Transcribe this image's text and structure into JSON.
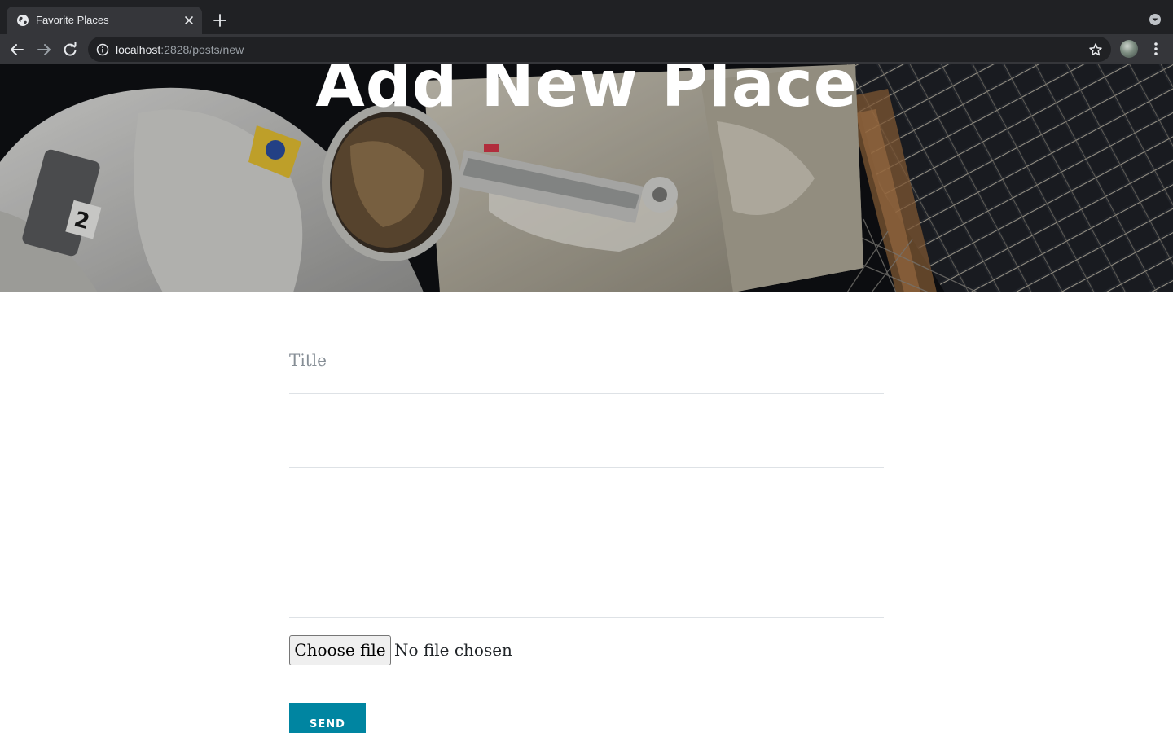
{
  "browser": {
    "tab_title": "Favorite Places",
    "url_host": "localhost",
    "url_rest": ":2828/posts/new"
  },
  "icons": {
    "favicon": "globe-icon",
    "tab_close": "close-icon",
    "new_tab": "plus-icon",
    "tabstrip_menu": "chevron-down-icon",
    "back": "arrow-left-icon",
    "forward": "arrow-right-icon",
    "reload": "reload-icon",
    "site_info": "info-icon",
    "bookmark": "star-icon",
    "menu": "kebab-menu-icon"
  },
  "hero": {
    "title": "Add New Place"
  },
  "form": {
    "title_placeholder": "Title",
    "file_button_label": "Choose file",
    "file_status": "No file chosen",
    "send_label": "SEND"
  },
  "colors": {
    "accent": "#0085a1",
    "chrome_dark": "#202124",
    "chrome_mid": "#35363a"
  }
}
